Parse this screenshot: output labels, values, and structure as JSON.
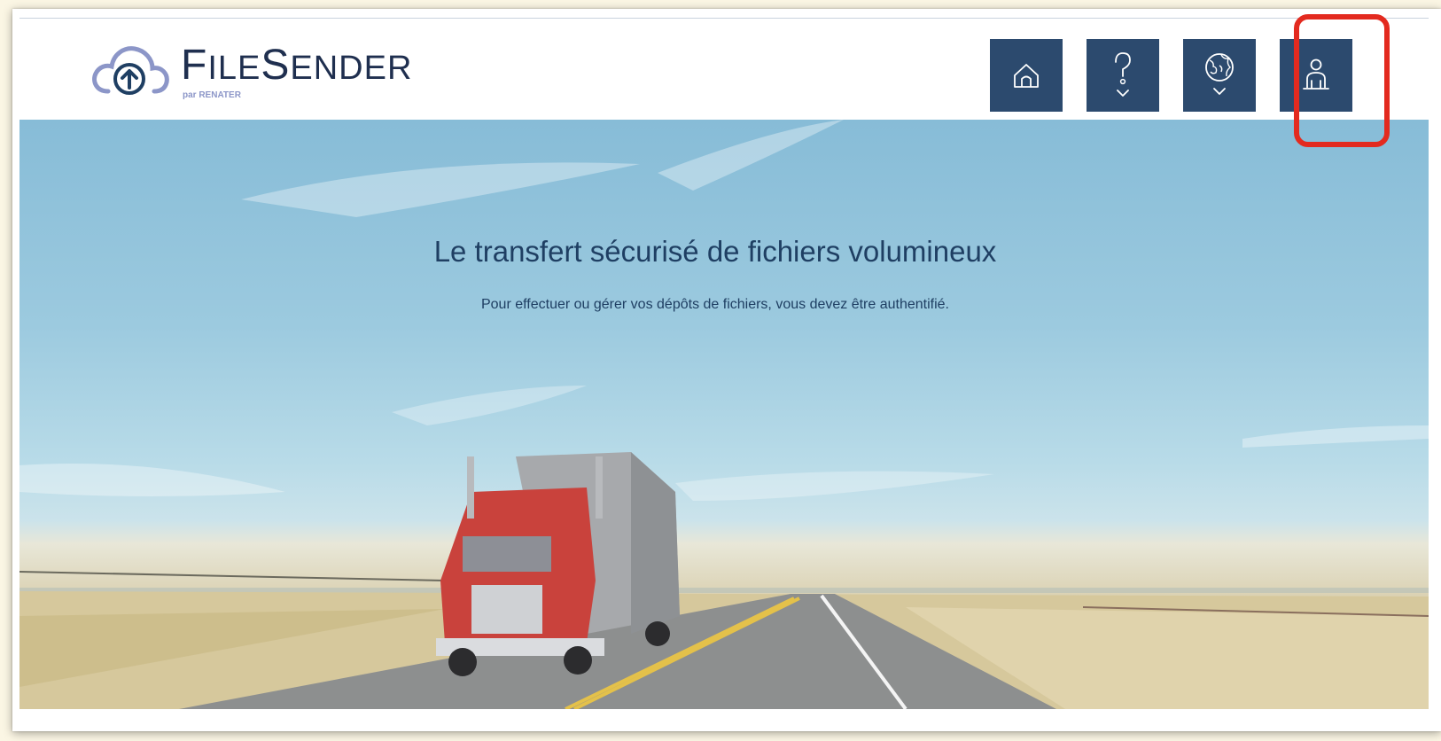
{
  "header": {
    "logo": {
      "name_initial_1": "F",
      "name_rest_1": "ILE",
      "name_initial_2": "S",
      "name_rest_2": "ENDER",
      "subtitle": "par RENATER",
      "icon": "cloud-upload-icon"
    },
    "nav": [
      {
        "name": "home-button",
        "icon": "home-icon"
      },
      {
        "name": "help-button",
        "icon": "help-icon"
      },
      {
        "name": "language-button",
        "icon": "globe-icon"
      },
      {
        "name": "user-login-button",
        "icon": "user-icon"
      }
    ]
  },
  "hero": {
    "title": "Le transfert sécurisé de fichiers volumineux",
    "subtitle": "Pour effectuer ou gérer vos dépôts de fichiers, vous devez être authentifié."
  },
  "colors": {
    "nav_button_bg": "#2c4a6e",
    "text_dark": "#1f3f63",
    "logo_cloud": "#8c96c8",
    "highlight": "#e32a1f"
  }
}
